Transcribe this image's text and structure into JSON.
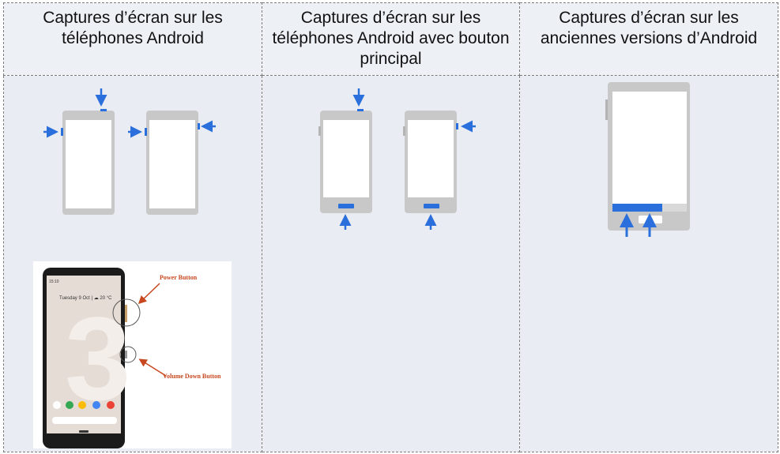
{
  "columns": [
    {
      "header": "Captures d’écran sur les téléphones Android"
    },
    {
      "header": "Captures d’écran sur les téléphones Android avec bouton principal"
    },
    {
      "header": "Captures d’écran sur les anciennes versions d’Android"
    }
  ],
  "photo": {
    "status_time": "15:10",
    "date_text": "Tuesday 9 Oct | ☁ 20 °C",
    "big_number": "3",
    "power_label": "Power Button",
    "volume_label": "Volume Down Button"
  },
  "colors": {
    "arrow": "#2a6fdb",
    "phone_frame": "#c8c8c8",
    "annotation": "#c8471f"
  }
}
